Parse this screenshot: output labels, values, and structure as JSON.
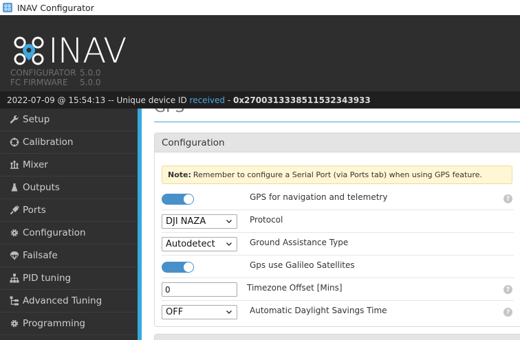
{
  "window": {
    "title": "INAV Configurator",
    "icon": "inav-app-icon"
  },
  "header": {
    "logo_text": "INAV",
    "configurator_label": "CONFIGURATOR",
    "configurator_version": "5.0.0",
    "firmware_label": "FC FIRMWARE",
    "firmware_version": "5.0.0"
  },
  "status": {
    "timestamp": "2022-07-09 @ 15:54:13",
    "separator": " -- Unique device ID ",
    "received": "received",
    "dash": " - ",
    "device_id": "0x27003133385115323439​33"
  },
  "sidebar": {
    "items": [
      {
        "label": "Setup",
        "icon": "wrench-icon"
      },
      {
        "label": "Calibration",
        "icon": "crosshair-icon"
      },
      {
        "label": "Mixer",
        "icon": "mixer-icon"
      },
      {
        "label": "Outputs",
        "icon": "flask-icon"
      },
      {
        "label": "Ports",
        "icon": "plug-icon"
      },
      {
        "label": "Configuration",
        "icon": "gear-icon"
      },
      {
        "label": "Failsafe",
        "icon": "parachute-icon"
      },
      {
        "label": "PID tuning",
        "icon": "sitemap-icon"
      },
      {
        "label": "Advanced Tuning",
        "icon": "tree-icon"
      },
      {
        "label": "Programming",
        "icon": "gear-icon"
      }
    ]
  },
  "main": {
    "page_title": "GPS",
    "panel_title": "Configuration",
    "note_bold": "Note:",
    "note_text": "Remember to configure a Serial Port (via Ports tab) when using GPS feature.",
    "rows": [
      {
        "type": "toggle",
        "label": "GPS for navigation and telemetry",
        "checked": true,
        "help": "?"
      },
      {
        "type": "select",
        "value": "DJI NAZA",
        "label": "Protocol"
      },
      {
        "type": "select",
        "value": "Autodetect",
        "label": "Ground Assistance Type"
      },
      {
        "type": "toggle",
        "label": "Gps use Galileo Satellites",
        "checked": true
      },
      {
        "type": "input",
        "value": "0",
        "label": "Timezone Offset [Mins]",
        "help": "?"
      },
      {
        "type": "select",
        "value": "OFF",
        "label": "Automatic Daylight Savings Time",
        "help": "?"
      }
    ]
  },
  "colors": {
    "accent": "#37a8db",
    "toggle_on": "#4a90c8",
    "header_bg": "#2e2e2e",
    "sidebar_bg": "#303030",
    "note_bg": "#fff6d4"
  }
}
